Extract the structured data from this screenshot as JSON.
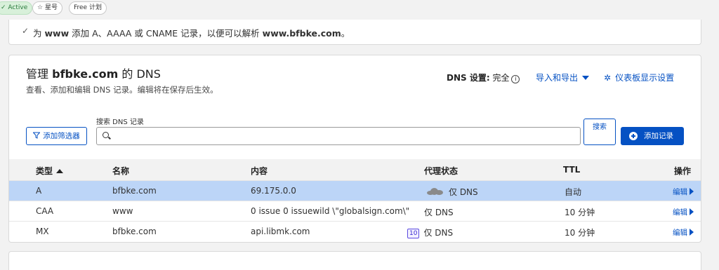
{
  "topbar": {
    "status": "Active",
    "star_label": "星号",
    "plan_label": "Free 计划"
  },
  "banner": {
    "prefix": "为",
    "host": "www",
    "middle": "添加 A、AAAA 或 CNAME 记录，以便可以解析",
    "domain": "www.bfbke.com",
    "suffix": "。"
  },
  "dns_card": {
    "title_prefix": "管理",
    "title_domain": "bfbke.com",
    "title_suffix": "的 DNS",
    "subtitle": "查看、添加和编辑 DNS 记录。编辑将在保存后生效。",
    "dns_setting_label": "DNS 设置:",
    "dns_setting_value": "完全",
    "import_export": "导入和导出",
    "dashboard_settings": "仪表板显示设置",
    "filter_button": "添加筛选器",
    "search_label": "搜索 DNS 记录",
    "search_value": "",
    "search_button": "搜索",
    "add_record": "添加记录",
    "columns": [
      "类型",
      "名称",
      "内容",
      "代理状态",
      "TTL",
      "操作"
    ],
    "records": [
      {
        "type": "A",
        "name": "bfbke.com",
        "content": "69.175.0.0",
        "badge": "",
        "proxy": "仅 DNS",
        "ttl": "自动",
        "action": "编辑"
      },
      {
        "type": "CAA",
        "name": "www",
        "content": "0 issue 0 issuewild \\\"globalsign.com\\\"",
        "badge": "",
        "proxy": "仅 DNS",
        "ttl": "10 分钟",
        "action": "编辑"
      },
      {
        "type": "MX",
        "name": "bfbke.com",
        "content": "api.libmk.com",
        "badge": "10",
        "proxy": "仅 DNS",
        "ttl": "10 分钟",
        "action": "编辑"
      }
    ]
  },
  "colors": {
    "accent": "#0551c3",
    "selected_row": "#bcd5f7",
    "active_green": "#2a7b3c"
  },
  "icons": [
    "check-icon",
    "star-icon",
    "info-icon",
    "chevron-down-icon",
    "gear-icon",
    "filter-icon",
    "search-icon",
    "plus-circle-icon",
    "sort-up-icon",
    "cloud-icon",
    "chevron-right-icon"
  ]
}
